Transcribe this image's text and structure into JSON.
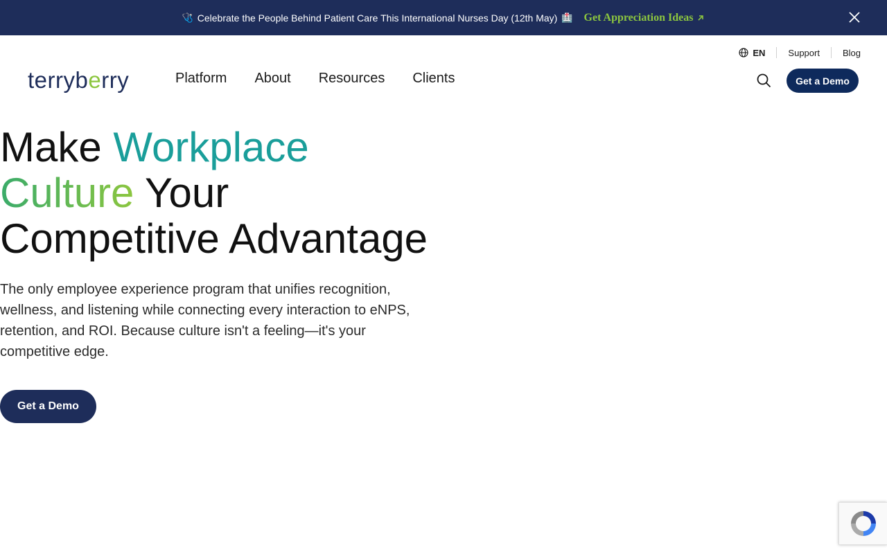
{
  "announcement": {
    "emoji_left": "🩺",
    "text": "Celebrate the People Behind Patient Care This International Nurses Day (12th May)",
    "emoji_right": "🏥",
    "link_label": "Get Appreciation Ideas"
  },
  "utility": {
    "language": "EN",
    "support": "Support",
    "blog": "Blog"
  },
  "logo": {
    "part1": "terryb",
    "part_e": "e",
    "part2": "rry"
  },
  "nav": {
    "items": [
      "Platform",
      "About",
      "Resources",
      "Clients"
    ],
    "cta_label": "Get a Demo"
  },
  "hero": {
    "title_make": "Make ",
    "title_workplace": "Workplace",
    "title_culture": "Culture",
    "title_your": " Your",
    "title_line3": "Competitive Advantage",
    "subtitle": "The only employee experience program that unifies recognition, wellness, and listening while connecting every interaction to eNPS, retention, and ROI. Because culture isn't a feeling—it's your competitive edge.",
    "cta_label": "Get a Demo"
  },
  "colors": {
    "announcement_bg": "#1e2d5a",
    "accent_green": "#8cc63f",
    "accent_teal": "#1a9e9a",
    "button_navy": "#0e2a5c"
  },
  "icons": [
    "globe-icon",
    "search-icon",
    "close-icon",
    "arrow-up-right-icon",
    "recaptcha-icon"
  ]
}
